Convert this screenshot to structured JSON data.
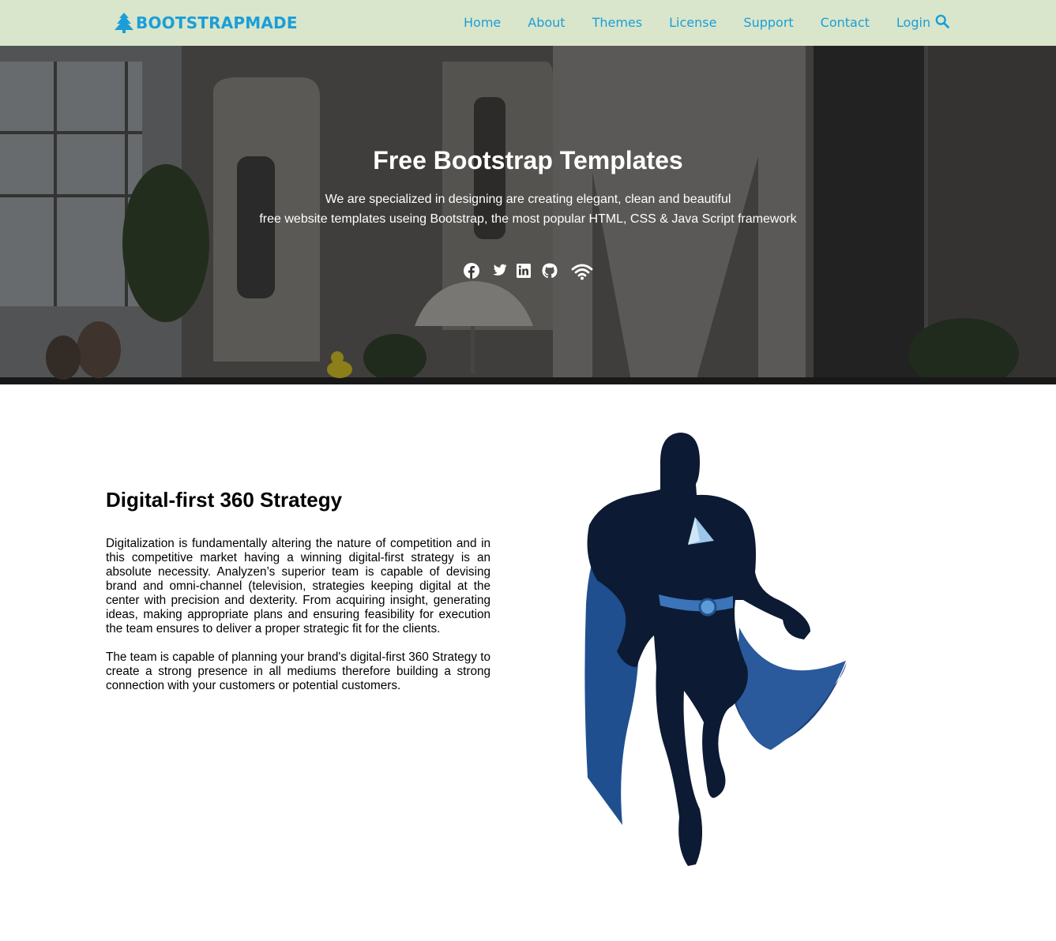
{
  "brand": {
    "name": "BOOTSTRAPMADE",
    "logo_icon": "tree-icon",
    "color": "#1b9ed8"
  },
  "nav": {
    "links": [
      "Home",
      "About",
      "Themes",
      "License",
      "Support",
      "Contact",
      "Login"
    ],
    "search_icon": "search-icon",
    "background": "#d9e6cb"
  },
  "hero": {
    "title": "Free Bootstrap Templates",
    "subtitle_line1": "We are specialized in designing are creating elegant, clean and beautiful",
    "subtitle_line2": "free website templates useing Bootstrap, the most popular HTML, CSS & Java Script framework",
    "social_icons": [
      "facebook-icon",
      "twitter-icon",
      "linkedin-icon",
      "github-icon",
      "wifi-icon"
    ]
  },
  "feature": {
    "title": "Digital-first 360 Strategy",
    "paragraph1": "Digitalization is fundamentally altering the nature of competition and in this competitive market having a winning digital-first strategy is an absolute necessity. Analyzen’s superior team is capable of devising brand and omni-channel (television, strategies keeping digital at the center with precision and dexterity. From acquiring insight, generating ideas, making appropriate plans and ensuring feasibility for execution the team ensures to deliver a proper strategic fit for the clients.",
    "paragraph2": "The team is capable of planning your brand's digital-first 360 Strategy to create a strong presence in all mediums therefore building a strong connection with your customers or potential customers.",
    "illustration": "superhero-illustration"
  }
}
